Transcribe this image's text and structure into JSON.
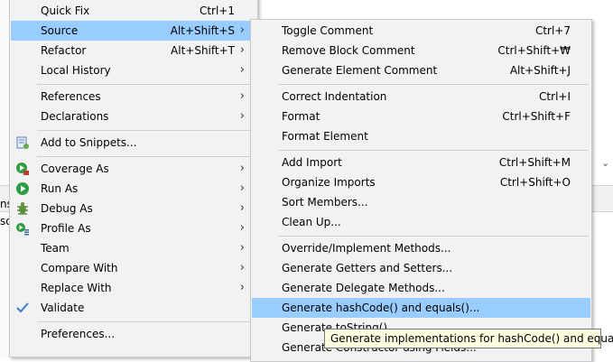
{
  "background": {
    "left_fragment_1": "ns",
    "left_fragment_2": "so"
  },
  "main_menu": {
    "items": [
      {
        "label": "Quick Fix",
        "shortcut": "Ctrl+1",
        "submenu": false
      },
      {
        "label": "Source",
        "shortcut": "Alt+Shift+S",
        "submenu": true,
        "selected": true
      },
      {
        "label": "Refactor",
        "shortcut": "Alt+Shift+T",
        "submenu": true
      },
      {
        "label": "Local History",
        "shortcut": "",
        "submenu": true
      },
      {
        "label": "References",
        "shortcut": "",
        "submenu": true
      },
      {
        "label": "Declarations",
        "shortcut": "",
        "submenu": true
      },
      {
        "label": "Add to Snippets...",
        "icon": "snippets-icon"
      },
      {
        "label": "Coverage As",
        "icon": "coverage-icon",
        "submenu": true
      },
      {
        "label": "Run As",
        "icon": "run-icon",
        "submenu": true
      },
      {
        "label": "Debug As",
        "icon": "debug-bug-icon",
        "submenu": true
      },
      {
        "label": "Profile As",
        "icon": "profile-icon",
        "submenu": true
      },
      {
        "label": "Team",
        "submenu": true
      },
      {
        "label": "Compare With",
        "submenu": true
      },
      {
        "label": "Replace With",
        "submenu": true
      },
      {
        "label": "Validate",
        "icon": "checkmark-icon"
      },
      {
        "label": "Preferences..."
      }
    ],
    "arrow": "›"
  },
  "source_submenu": {
    "items": [
      {
        "label": "Toggle Comment",
        "shortcut": "Ctrl+7"
      },
      {
        "label": "Remove Block Comment",
        "shortcut": "Ctrl+Shift+₩"
      },
      {
        "label": "Generate Element Comment",
        "shortcut": "Alt+Shift+J"
      },
      {
        "label": "Correct Indentation",
        "shortcut": "Ctrl+I"
      },
      {
        "label": "Format",
        "shortcut": "Ctrl+Shift+F"
      },
      {
        "label": "Format Element",
        "shortcut": ""
      },
      {
        "label": "Add Import",
        "shortcut": "Ctrl+Shift+M"
      },
      {
        "label": "Organize Imports",
        "shortcut": "Ctrl+Shift+O"
      },
      {
        "label": "Sort Members...",
        "shortcut": ""
      },
      {
        "label": "Clean Up...",
        "shortcut": ""
      },
      {
        "label": "Override/Implement Methods...",
        "shortcut": ""
      },
      {
        "label": "Generate Getters and Setters...",
        "shortcut": ""
      },
      {
        "label": "Generate Delegate Methods...",
        "shortcut": ""
      },
      {
        "label": "Generate hashCode() and equals()...",
        "shortcut": "",
        "selected": true
      },
      {
        "label": "Generate toString()...",
        "shortcut": ""
      },
      {
        "label": "Generate Constructor using Fields...",
        "shortcut": ""
      }
    ],
    "scroll_arrow": "⌄"
  },
  "tooltip": {
    "text": "Generate implementations for hashCode() and equals()"
  },
  "colors": {
    "selection": "#99ccff",
    "menu_background": "#f2f2f2",
    "tooltip_background": "#ffffe1"
  }
}
